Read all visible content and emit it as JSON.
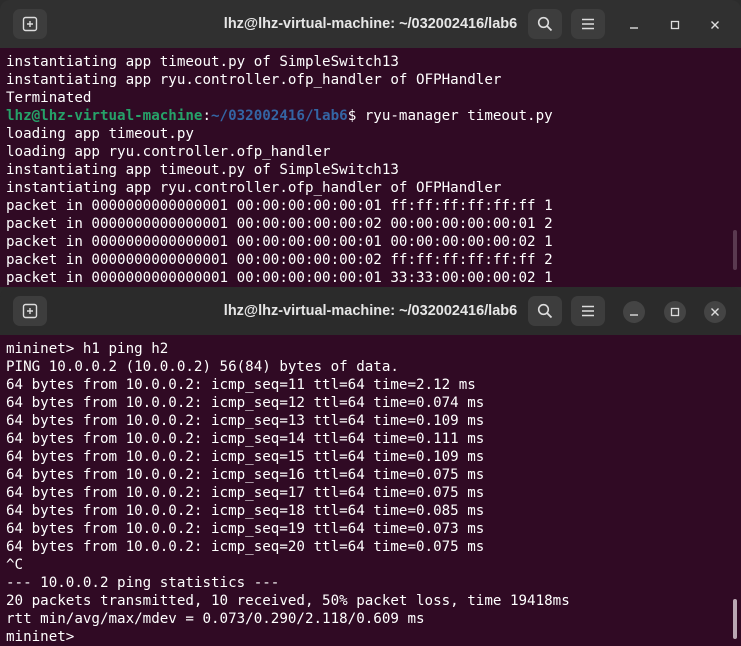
{
  "top_window": {
    "title": "lhz@lhz-virtual-machine: ~/032002416/lab6",
    "lines": [
      "instantiating app timeout.py of SimpleSwitch13",
      "instantiating app ryu.controller.ofp_handler of OFPHandler",
      "Terminated"
    ],
    "prompt_user": "lhz@lhz-virtual-machine",
    "prompt_sep": ":",
    "prompt_path": "~/032002416/lab6",
    "prompt_cmd": "$ ryu-manager timeout.py",
    "after_lines": [
      "loading app timeout.py",
      "loading app ryu.controller.ofp_handler",
      "instantiating app timeout.py of SimpleSwitch13",
      "instantiating app ryu.controller.ofp_handler of OFPHandler",
      "packet in 0000000000000001 00:00:00:00:00:01 ff:ff:ff:ff:ff:ff 1",
      "packet in 0000000000000001 00:00:00:00:00:02 00:00:00:00:00:01 2",
      "packet in 0000000000000001 00:00:00:00:00:01 00:00:00:00:00:02 1",
      "packet in 0000000000000001 00:00:00:00:00:02 ff:ff:ff:ff:ff:ff 2",
      "packet in 0000000000000001 00:00:00:00:00:01 33:33:00:00:00:02 1"
    ]
  },
  "bottom_window": {
    "title": "lhz@lhz-virtual-machine: ~/032002416/lab6",
    "lines": [
      "mininet> h1 ping h2",
      "PING 10.0.0.2 (10.0.0.2) 56(84) bytes of data.",
      "64 bytes from 10.0.0.2: icmp_seq=11 ttl=64 time=2.12 ms",
      "64 bytes from 10.0.0.2: icmp_seq=12 ttl=64 time=0.074 ms",
      "64 bytes from 10.0.0.2: icmp_seq=13 ttl=64 time=0.109 ms",
      "64 bytes from 10.0.0.2: icmp_seq=14 ttl=64 time=0.111 ms",
      "64 bytes from 10.0.0.2: icmp_seq=15 ttl=64 time=0.109 ms",
      "64 bytes from 10.0.0.2: icmp_seq=16 ttl=64 time=0.075 ms",
      "64 bytes from 10.0.0.2: icmp_seq=17 ttl=64 time=0.075 ms",
      "64 bytes from 10.0.0.2: icmp_seq=18 ttl=64 time=0.085 ms",
      "64 bytes from 10.0.0.2: icmp_seq=19 ttl=64 time=0.073 ms",
      "64 bytes from 10.0.0.2: icmp_seq=20 ttl=64 time=0.075 ms",
      "^C",
      "--- 10.0.0.2 ping statistics ---",
      "20 packets transmitted, 10 received, 50% packet loss, time 19418ms",
      "rtt min/avg/max/mdev = 0.073/0.290/2.118/0.609 ms",
      "mininet>"
    ]
  },
  "colors": {
    "terminal_bg": "#300a24",
    "prompt_user": "#26a269",
    "prompt_path": "#3465a4"
  },
  "icons": [
    "new-tab-icon",
    "search-icon",
    "hamburger-menu-icon",
    "minimize-icon",
    "maximize-icon",
    "close-icon"
  ]
}
